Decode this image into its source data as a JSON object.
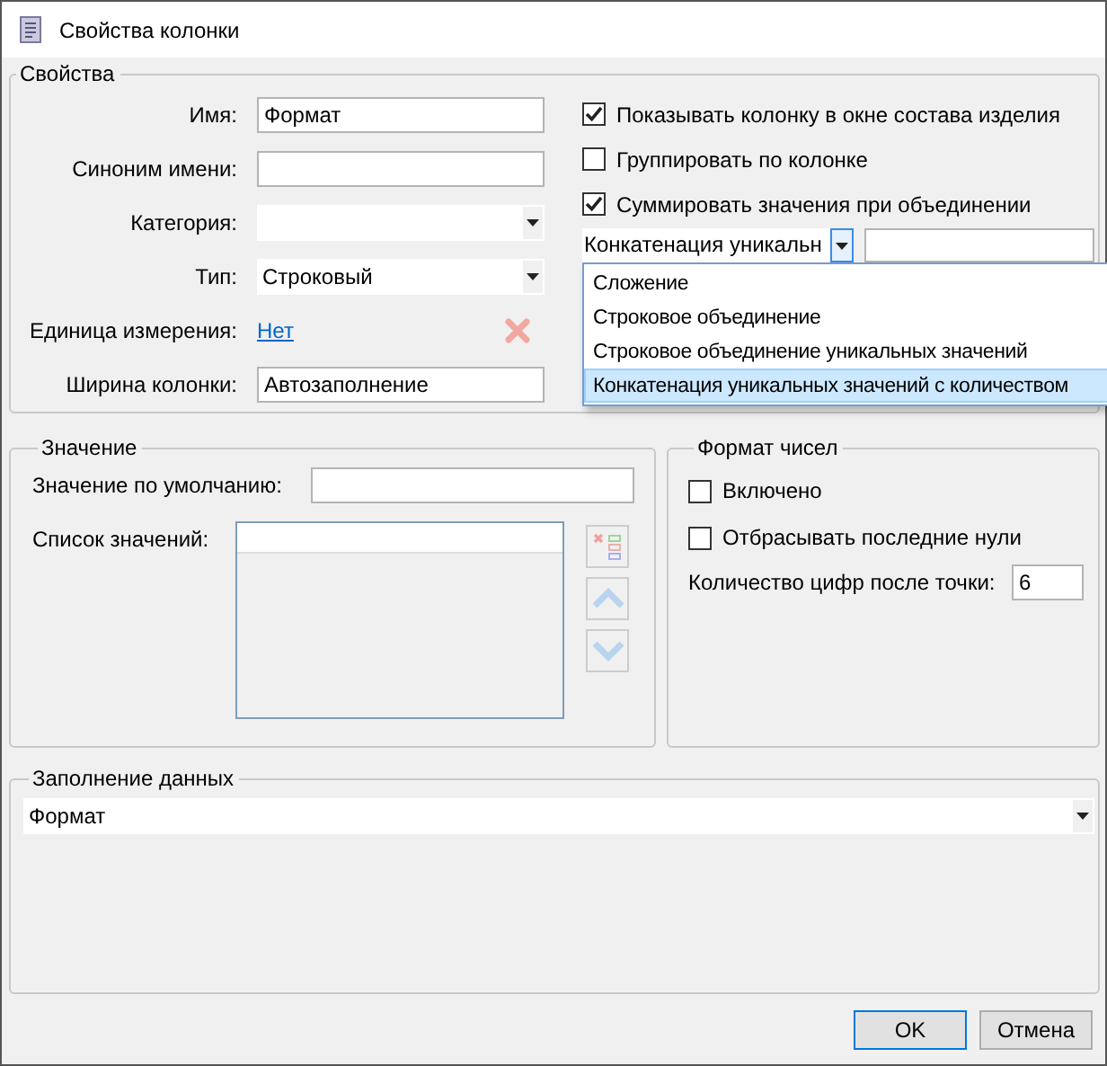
{
  "window": {
    "title": "Свойства колонки"
  },
  "properties": {
    "title": "Свойства",
    "fields": [
      {
        "label": "Имя:",
        "kind": "text",
        "value": "Формат"
      },
      {
        "label": "Синоним имени:",
        "kind": "text"
      },
      {
        "label": "Категория:",
        "kind": "combo"
      },
      {
        "label": "Тип:",
        "kind": "combo",
        "value": "Строковый"
      },
      {
        "label": "Единица измерения:",
        "kind": "link",
        "value": "Нет"
      },
      {
        "label": "Ширина колонки:",
        "kind": "text",
        "value": "Автозаполнение"
      }
    ],
    "options": [
      {
        "label": "Показывать колонку в окне состава изделия",
        "checked": true
      },
      {
        "label": "Группировать по колонке",
        "checked": false
      },
      {
        "label": "Суммировать значения при объединении",
        "checked": true
      }
    ],
    "aggregation": {
      "value": "Конкатенация уникальн",
      "expanded": true,
      "items": [
        {
          "label": "Сложение",
          "selected": false
        },
        {
          "label": "Строковое объединение",
          "selected": false
        },
        {
          "label": "Строковое объединение уникальных значений",
          "selected": false
        },
        {
          "label": "Конкатенация уникальных значений с количеством",
          "selected": true
        }
      ]
    }
  },
  "value_group": {
    "title": "Значение",
    "default_label": "Значение по умолчанию:",
    "list_label": "Список значений:"
  },
  "number_format": {
    "title": "Формат чисел",
    "options": [
      {
        "label": "Включено",
        "checked": false
      },
      {
        "label": "Отбрасывать последние нули",
        "checked": false
      }
    ],
    "digits_label": "Количество цифр после точки:",
    "digits": "6"
  },
  "data_fill": {
    "title": "Заполнение данных",
    "value": "Формат"
  },
  "buttons": [
    {
      "label": "OK",
      "default": true
    },
    {
      "label": "Отмена",
      "default": false
    }
  ]
}
